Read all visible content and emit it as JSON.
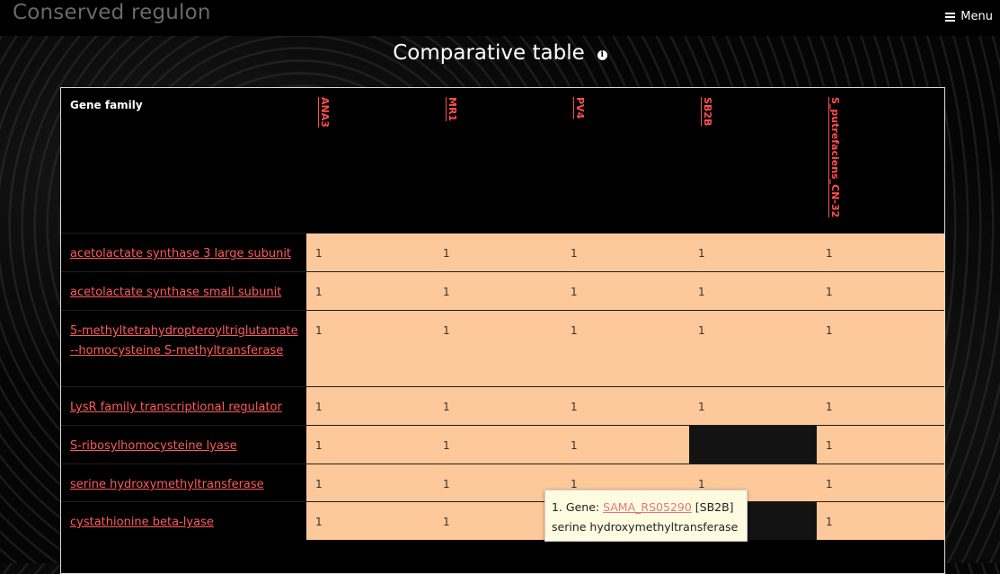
{
  "header": {
    "app_title": "Conserved regulon",
    "menu_label": "Menu"
  },
  "page": {
    "title": "Comparative table"
  },
  "table": {
    "family_header": "Gene family",
    "columns": [
      "ANA3",
      "MR1",
      "PV4",
      "SB2B",
      "S_putrefaciens_CN-32"
    ],
    "rows": [
      {
        "family": "acetolactate synthase 3 large subunit",
        "values": [
          "1",
          "1",
          "1",
          "1",
          "1"
        ]
      },
      {
        "family": "acetolactate synthase small subunit",
        "values": [
          "1",
          "1",
          "1",
          "1",
          "1"
        ]
      },
      {
        "family": "5-methyltetrahydropteroyltriglutamate--homocysteine S-methyltransferase",
        "values": [
          "1",
          "1",
          "1",
          "1",
          "1"
        ]
      },
      {
        "family": "LysR family transcriptional regulator",
        "values": [
          "1",
          "1",
          "1",
          "1",
          "1"
        ]
      },
      {
        "family": "S-ribosylhomocysteine lyase",
        "values": [
          "1",
          "1",
          "1",
          "",
          "1"
        ]
      },
      {
        "family": "serine hydroxymethyltransferase",
        "values": [
          "1",
          "1",
          "1",
          "1",
          "1"
        ]
      },
      {
        "family": "cystathionine beta-lyase",
        "values": [
          "1",
          "1",
          "",
          "",
          "1"
        ]
      }
    ]
  },
  "tooltip": {
    "prefix": "1. Gene: ",
    "gene_link": "SAMA_RS05290",
    "organism": "[SB2B]",
    "description": "serine hydroxymethyltransferase"
  },
  "colors": {
    "cell_filled": "#fec99a",
    "cell_empty": "#131313",
    "link": "#ff5a5a"
  }
}
